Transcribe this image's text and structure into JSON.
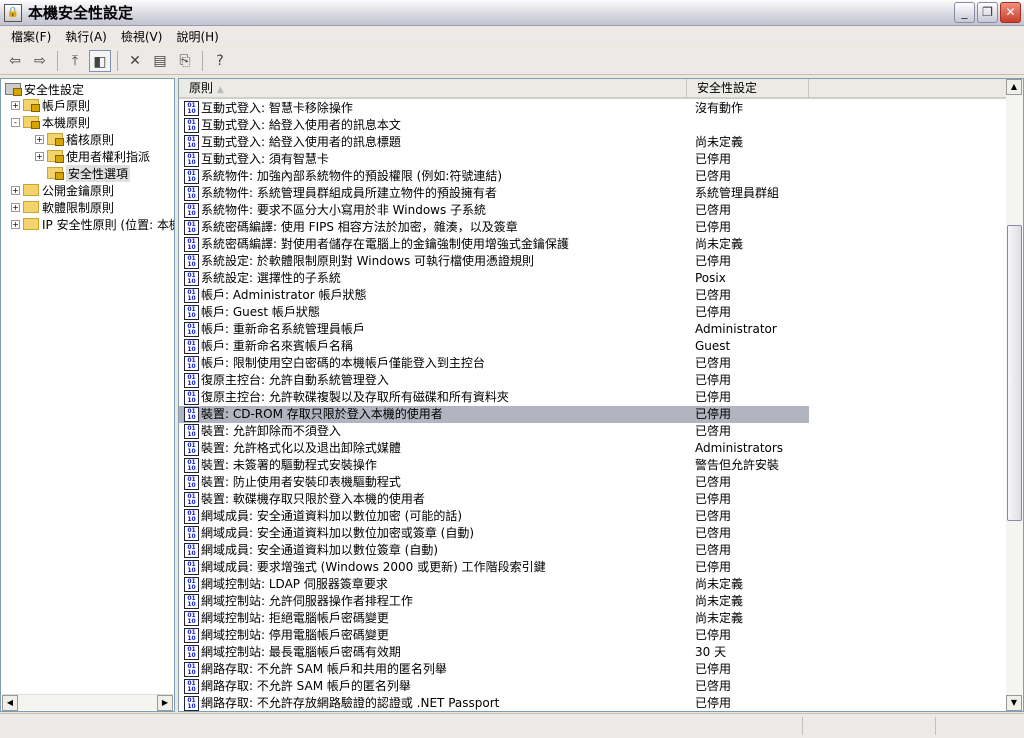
{
  "window": {
    "title": "本機安全性設定",
    "icon": "local-security-icon"
  },
  "menu": [
    "檔案(F)",
    "執行(A)",
    "檢視(V)",
    "說明(H)"
  ],
  "toolbar": {
    "icons": [
      "back-arrow-icon",
      "forward-arrow-icon",
      "up-folder-icon",
      "show-hide-tree-icon",
      "delete-icon",
      "properties-icon",
      "export-list-icon",
      "help-icon"
    ]
  },
  "tree": {
    "root": "安全性設定",
    "items": [
      {
        "label": "帳戶原則",
        "expander": "+"
      },
      {
        "label": "本機原則",
        "expander": "-"
      },
      {
        "label": "稽核原則",
        "expander": "+"
      },
      {
        "label": "使用者權利指派",
        "expander": "+"
      },
      {
        "label": "安全性選項",
        "expander": ""
      },
      {
        "label": "公開金鑰原則",
        "expander": "+"
      },
      {
        "label": "軟體限制原則",
        "expander": "+"
      },
      {
        "label": "IP 安全性原則 (位置: 本機",
        "expander": "+"
      }
    ]
  },
  "list": {
    "columns": [
      "原則",
      "安全性設定"
    ],
    "selected_index": 18,
    "rows": [
      [
        "互動式登入: 智慧卡移除操作",
        "沒有動作"
      ],
      [
        "互動式登入: 給登入使用者的訊息本文",
        ""
      ],
      [
        "互動式登入: 給登入使用者的訊息標題",
        "尚未定義"
      ],
      [
        "互動式登入: 須有智慧卡",
        "已停用"
      ],
      [
        "系統物件: 加強內部系統物件的預設權限 (例如:符號連結)",
        "已啓用"
      ],
      [
        "系統物件: 系統管理員群組成員所建立物件的預設擁有者",
        "系統管理員群組"
      ],
      [
        "系統物件: 要求不區分大小寫用於非 Windows 子系統",
        "已啓用"
      ],
      [
        "系統密碼編譯: 使用 FIPS 相容方法於加密，雜湊，以及簽章",
        "已停用"
      ],
      [
        "系統密碼編譯: 對使用者儲存在電腦上的金鑰強制使用增強式金鑰保護",
        "尚未定義"
      ],
      [
        "系統設定: 於軟體限制原則對 Windows 可執行檔使用憑證規則",
        "已停用"
      ],
      [
        "系統設定: 選擇性的子系統",
        "Posix"
      ],
      [
        "帳戶: Administrator 帳戶狀態",
        "已啓用"
      ],
      [
        "帳戶: Guest 帳戶狀態",
        "已停用"
      ],
      [
        "帳戶: 重新命名系統管理員帳戶",
        "Administrator"
      ],
      [
        "帳戶: 重新命名來賓帳戶名稱",
        "Guest"
      ],
      [
        "帳戶: 限制使用空白密碼的本機帳戶僅能登入到主控台",
        "已啓用"
      ],
      [
        "復原主控台: 允許自動系統管理登入",
        "已停用"
      ],
      [
        "復原主控台: 允許軟碟複製以及存取所有磁碟和所有資料夾",
        "已停用"
      ],
      [
        "裝置: CD-ROM 存取只限於登入本機的使用者",
        "已停用"
      ],
      [
        "裝置: 允許卸除而不須登入",
        "已啓用"
      ],
      [
        "裝置: 允許格式化以及退出卸除式媒體",
        "Administrators"
      ],
      [
        "裝置: 未簽署的驅動程式安裝操作",
        "警告但允許安裝"
      ],
      [
        "裝置: 防止使用者安裝印表機驅動程式",
        "已啓用"
      ],
      [
        "裝置: 軟碟機存取只限於登入本機的使用者",
        "已停用"
      ],
      [
        "網域成員: 安全通道資料加以數位加密 (可能的話)",
        "已啓用"
      ],
      [
        "網域成員: 安全通道資料加以數位加密或簽章 (自動)",
        "已啓用"
      ],
      [
        "網域成員: 安全通道資料加以數位簽章 (自動)",
        "已啓用"
      ],
      [
        "網域成員: 要求增強式 (Windows 2000 或更新) 工作階段索引鍵",
        "已停用"
      ],
      [
        "網域控制站: LDAP 伺服器簽章要求",
        "尚未定義"
      ],
      [
        "網域控制站: 允許伺服器操作者排程工作",
        "尚未定義"
      ],
      [
        "網域控制站: 拒絕電腦帳戶密碼變更",
        "尚未定義"
      ],
      [
        "網域控制站: 停用電腦帳戶密碼變更",
        "已停用"
      ],
      [
        "網域控制站: 最長電腦帳戶密碼有效期",
        "30 天"
      ],
      [
        "網路存取: 不允許 SAM 帳戶和共用的匿名列舉",
        "已停用"
      ],
      [
        "網路存取: 不允許 SAM 帳戶的匿名列舉",
        "已啓用"
      ],
      [
        "網路存取: 不允許存放網路驗證的認證或 .NET Passport",
        "已停用"
      ]
    ]
  }
}
